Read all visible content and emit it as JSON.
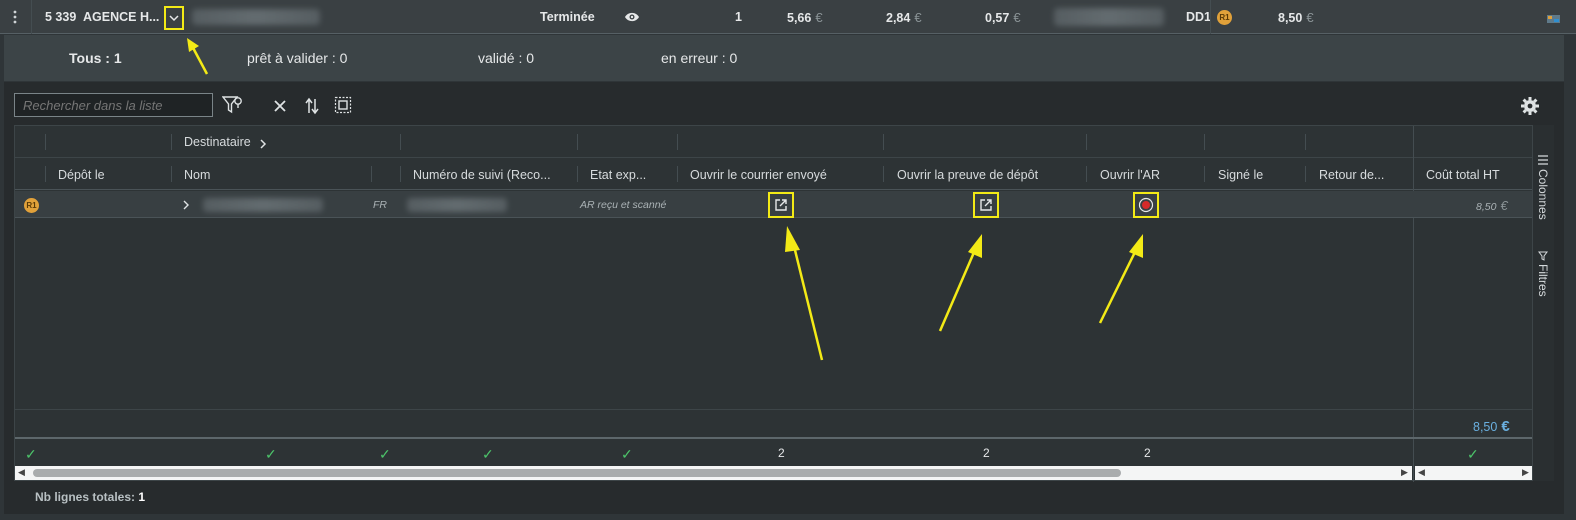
{
  "top_row": {
    "menu_icon": "vertical-dots-icon",
    "order_id": "5 339",
    "agency": "AGENCE H...",
    "status": "Terminée",
    "view_icon": "eye-icon",
    "count": "1",
    "amount1": "5,66",
    "amount2": "2,84",
    "amount3": "0,57",
    "code": "DD1",
    "badge": "R1",
    "total": "8,50",
    "currency": "€"
  },
  "status_tabs": {
    "all": "Tous : 1",
    "ready": "prêt à valider : 0",
    "validated": "validé : 0",
    "error": "en erreur : 0"
  },
  "toolbar": {
    "search_placeholder": "Rechercher dans la liste",
    "icons": [
      "filter-icon",
      "clear-icon",
      "sort-icon",
      "select-all-icon",
      "settings-icon"
    ]
  },
  "grid": {
    "group_header": "Destinataire",
    "columns": [
      "Dépôt le",
      "Nom",
      "Numéro de suivi (Reco...",
      "Etat exp...",
      "Ouvrir le courrier envoyé",
      "Ouvrir la preuve de dépôt",
      "Ouvrir l'AR",
      "Signé le",
      "Retour de...",
      "Coût total HT"
    ],
    "row": {
      "badge": "R1",
      "country": "FR",
      "state": "AR reçu et scanné",
      "cost": "8,50",
      "currency": "€"
    },
    "total_cost": "8,50",
    "total_currency": "€",
    "counts": {
      "courrier": "2",
      "preuve": "2",
      "ar": "2"
    }
  },
  "side_panel": {
    "columns": "Colonnes",
    "filters": "Filtres"
  },
  "footer": {
    "total_label": "Nb lignes totales:",
    "total_value": "1"
  }
}
